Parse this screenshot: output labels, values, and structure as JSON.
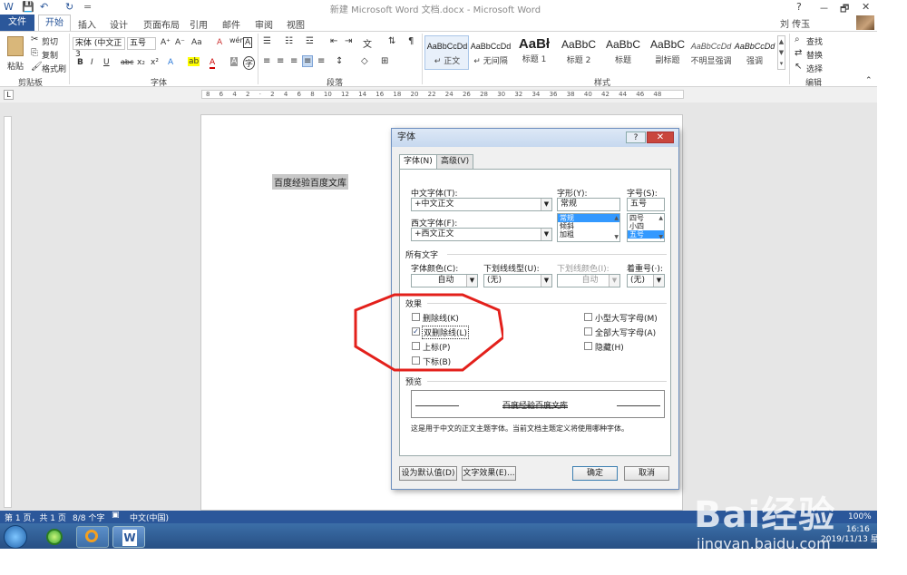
{
  "window": {
    "title": "新建 Microsoft Word 文档.docx - Microsoft Word",
    "user": "刘 传玉",
    "help": "?",
    "min": "－",
    "restore": "🗗",
    "close": "✕"
  },
  "quick_access": {
    "save": "💾",
    "undo": "↶",
    "redo": "↻",
    "more": "="
  },
  "tabs": [
    "文件",
    "开始",
    "插入",
    "设计",
    "页面布局",
    "引用",
    "邮件",
    "审阅",
    "视图"
  ],
  "ribbon": {
    "clipboard": {
      "paste": "粘贴",
      "cut": "剪切",
      "copy": "复制",
      "format_painter": "格式刷",
      "group": "剪贴板"
    },
    "font": {
      "font_name": "宋体 (中文正3",
      "font_size": "五号",
      "bold": "B",
      "italic": "I",
      "underline": "U",
      "strike": "abc",
      "sub": "x₂",
      "sup": "x²",
      "group": "字体",
      "grow": "A⁺",
      "shrink": "A⁻",
      "case": "Aa",
      "clear": "A",
      "phonetic": "wén",
      "border": "A",
      "highlight": "ab",
      "color": "A",
      "shade": "A",
      "enclose": "字"
    },
    "paragraph": {
      "group": "段落"
    },
    "styles": {
      "group": "样式",
      "items": [
        {
          "preview": "AaBbCcDd",
          "name": "↵ 正文"
        },
        {
          "preview": "AaBbCcDd",
          "name": "↵ 无间隔"
        },
        {
          "preview": "AaBł",
          "name": "标题 1"
        },
        {
          "preview": "AaBbC",
          "name": "标题 2"
        },
        {
          "preview": "AaBbC",
          "name": "标题"
        },
        {
          "preview": "AaBbC",
          "name": "副标题"
        },
        {
          "preview": "AaBbCcDd",
          "name": "不明显强调"
        },
        {
          "preview": "AaBbCcDd",
          "name": "强调"
        }
      ]
    },
    "editing": {
      "find": "查找",
      "replace": "替换",
      "select": "选择",
      "group": "编辑"
    }
  },
  "ruler_ticks": "8 6 4 2 · 2 4 6 8 10 12 14 16 18 20 22 24 26 28 30 32 34 36 38 40 42 44 46 48",
  "ruler_tab_stop": "L",
  "document": {
    "selected_text": "百度经验百度文库"
  },
  "dialog": {
    "title": "字体",
    "help": "?",
    "close": "✕",
    "tabs": [
      "字体(N)",
      "高级(V)"
    ],
    "chinese_font_label": "中文字体(T):",
    "chinese_font_value": "+中文正文",
    "western_font_label": "西文字体(F):",
    "western_font_value": "+西文正文",
    "style_label": "字形(Y):",
    "style_value": "常规",
    "style_options": [
      "常规",
      "倾斜",
      "加粗"
    ],
    "size_label": "字号(S):",
    "size_value": "五号",
    "size_options": [
      "四号",
      "小四",
      "五号"
    ],
    "all_text_section": "所有文字",
    "font_color_label": "字体颜色(C):",
    "font_color_value": "自动",
    "underline_label": "下划线线型(U):",
    "underline_value": "(无)",
    "underline_color_label": "下划线颜色(I):",
    "underline_color_value": "自动",
    "emphasis_label": "着重号(·):",
    "emphasis_value": "(无)",
    "effects_section": "效果",
    "effects_left": [
      {
        "label": "删除线(K)",
        "checked": false
      },
      {
        "label": "双删除线(L)",
        "checked": true
      },
      {
        "label": "上标(P)",
        "checked": false
      },
      {
        "label": "下标(B)",
        "checked": false
      }
    ],
    "effects_right": [
      {
        "label": "小型大写字母(M)",
        "checked": false
      },
      {
        "label": "全部大写字母(A)",
        "checked": false
      },
      {
        "label": "隐藏(H)",
        "checked": false
      }
    ],
    "preview_section": "预览",
    "preview_text": "百度经验百度文库",
    "preview_note": "这是用于中文的正文主题字体。当前文档主题定义将使用哪种字体。",
    "btn_default": "设为默认值(D)",
    "btn_effects": "文字效果(E)...",
    "btn_ok": "确定",
    "btn_cancel": "取消",
    "annotation_color": "#e3201b"
  },
  "status": {
    "page": "第 1 页，共 1 页",
    "words": "8/8 个字",
    "language": "中文(中国)",
    "zoom": "100%"
  },
  "taskbar": {
    "time": "16:16",
    "date": "2019/11/13 星期三"
  },
  "watermark": {
    "brand": "Bai经验",
    "url": "jingyan.baidu.com"
  }
}
